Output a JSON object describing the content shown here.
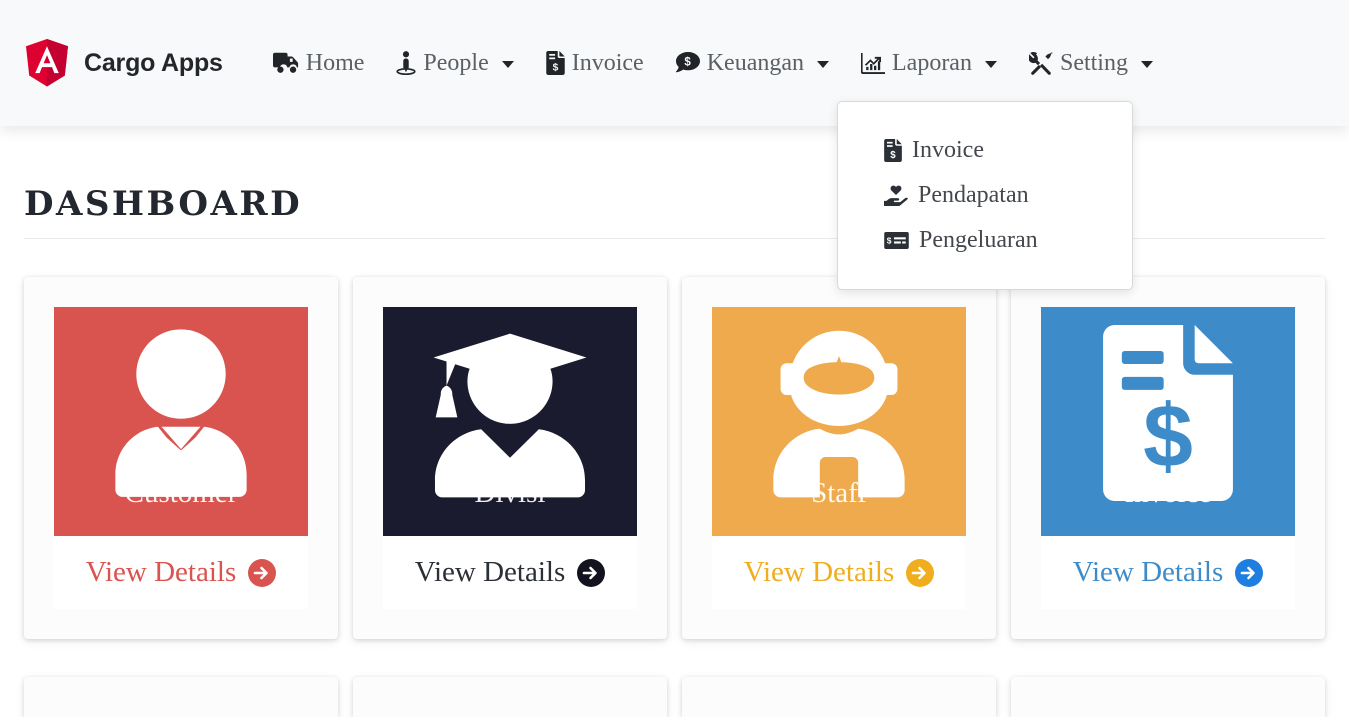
{
  "brand": {
    "text": "Cargo Apps",
    "logo_icon": "angular-shield-logo",
    "logo_color": "#dd0031",
    "logo_color_dark": "#c3002f"
  },
  "navbar": {
    "background": "#f8f9fa",
    "items": [
      {
        "label": "Home",
        "icon": "truck-icon",
        "has_caret": false
      },
      {
        "label": "People",
        "icon": "street-view-icon",
        "has_caret": true
      },
      {
        "label": "Invoice",
        "icon": "file-invoice-dollar-icon",
        "has_caret": false
      },
      {
        "label": "Keuangan",
        "icon": "comment-dollar-icon",
        "has_caret": true
      },
      {
        "label": "Laporan",
        "icon": "chart-line-icon",
        "has_caret": true,
        "open": true
      },
      {
        "label": "Setting",
        "icon": "tools-icon",
        "has_caret": true
      }
    ],
    "open_dropdown": {
      "owner": "Laporan",
      "items": [
        {
          "label": "Invoice",
          "icon": "file-invoice-dollar-icon"
        },
        {
          "label": "Pendapatan",
          "icon": "hand-holding-heart-icon"
        },
        {
          "label": "Pengeluaran",
          "icon": "money-check-icon"
        }
      ]
    }
  },
  "page": {
    "title": "Dashboard"
  },
  "cards": [
    {
      "label": "Customer",
      "icon": "user-tie-icon",
      "color": "#d9534f",
      "link_label": "View Details",
      "link_icon": "arrow-circle-right-icon"
    },
    {
      "label": "Divisi",
      "icon": "user-graduate-icon",
      "color": "#1b1b2f",
      "link_label": "View Details",
      "link_icon": "arrow-circle-right-icon"
    },
    {
      "label": "Staff",
      "icon": "user-astronaut-icon",
      "color": "#eeaa4d",
      "link_label": "View Details",
      "link_icon": "arrow-circle-right-icon",
      "link_color": "#f0ad1e"
    },
    {
      "label": "Invoice",
      "icon": "file-invoice-dollar-icon",
      "color": "#3e8bca",
      "link_label": "View Details",
      "link_icon": "arrow-circle-right-icon",
      "link_color": "#1f7fe0"
    }
  ]
}
